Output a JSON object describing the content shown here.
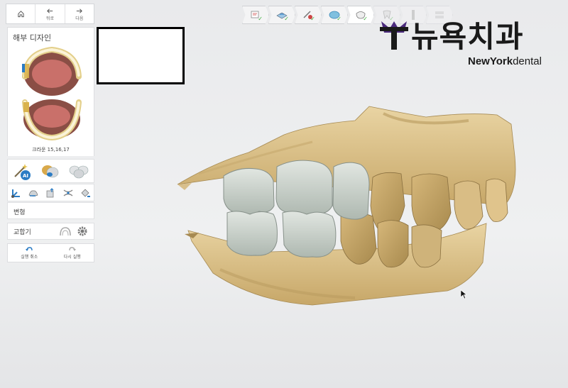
{
  "nav": {
    "back_label": "뒤로",
    "next_label": "다음"
  },
  "section_title": "해부 디자인",
  "thumbnail_caption": "크라운 15,16,17",
  "transform_label": "변형",
  "occlusion_label": "교합기",
  "undo_label": "실행 취소",
  "redo_label": "다시 실행",
  "ai_badge": "AI",
  "logo": {
    "korean": "뉴욕치과",
    "english_bold": "NewYork",
    "english_light": "dental"
  },
  "workflow_steps": [
    {
      "icon": "scan-form-icon",
      "done": true
    },
    {
      "icon": "model-tray-icon",
      "done": true
    },
    {
      "icon": "margin-tools-icon",
      "done": true
    },
    {
      "icon": "insertion-axis-icon",
      "done": true
    },
    {
      "icon": "crown-design-icon",
      "done": true,
      "active": true
    },
    {
      "icon": "tooth-shape-icon",
      "done": true,
      "dim": true
    },
    {
      "icon": "mill-bur-icon",
      "done": false,
      "dim": true
    },
    {
      "icon": "export-stack-icon",
      "done": false,
      "dim": true
    }
  ],
  "colors": {
    "gypsum": "#d9c08c",
    "crown": "#c4cdc6",
    "accent_blue": "#2b7cc4",
    "check_green": "#3cae3c",
    "logo_purple": "#4b2a7d"
  }
}
